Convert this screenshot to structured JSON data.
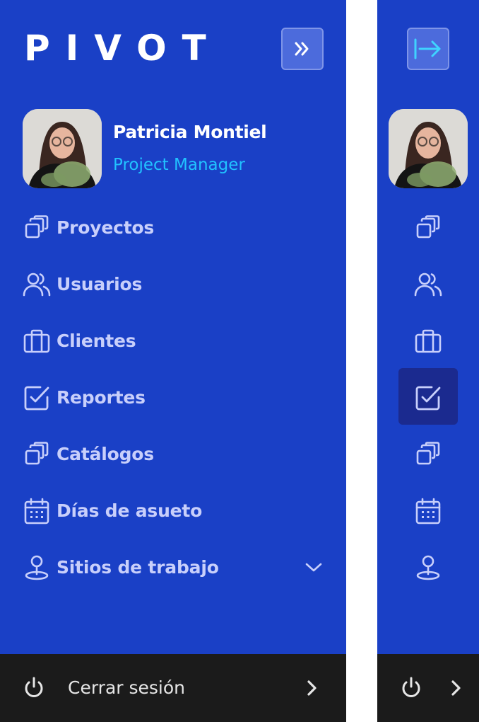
{
  "app": {
    "logo": "PIVOT"
  },
  "profile": {
    "name": "Patricia Montiel",
    "role": "Project Manager"
  },
  "nav": {
    "items": [
      {
        "label": "Proyectos",
        "icon": "stack-icon"
      },
      {
        "label": "Usuarios",
        "icon": "users-icon"
      },
      {
        "label": "Clientes",
        "icon": "briefcase-icon"
      },
      {
        "label": "Reportes",
        "icon": "checkbox-icon"
      },
      {
        "label": "Catálogos",
        "icon": "stack-icon"
      },
      {
        "label": "Días de asueto",
        "icon": "calendar-icon"
      },
      {
        "label": "Sitios de trabajo",
        "icon": "location-pin-icon",
        "has_submenu": true
      }
    ],
    "collapsed_active_index": 3
  },
  "logout": {
    "label": "Cerrar sesión"
  },
  "colors": {
    "sidebar_bg": "#1a40c6",
    "active_bg": "#1b2a8f",
    "nav_text": "#c8cffb",
    "role_text": "#21c2ff",
    "logout_bg": "#1b1b1b"
  }
}
